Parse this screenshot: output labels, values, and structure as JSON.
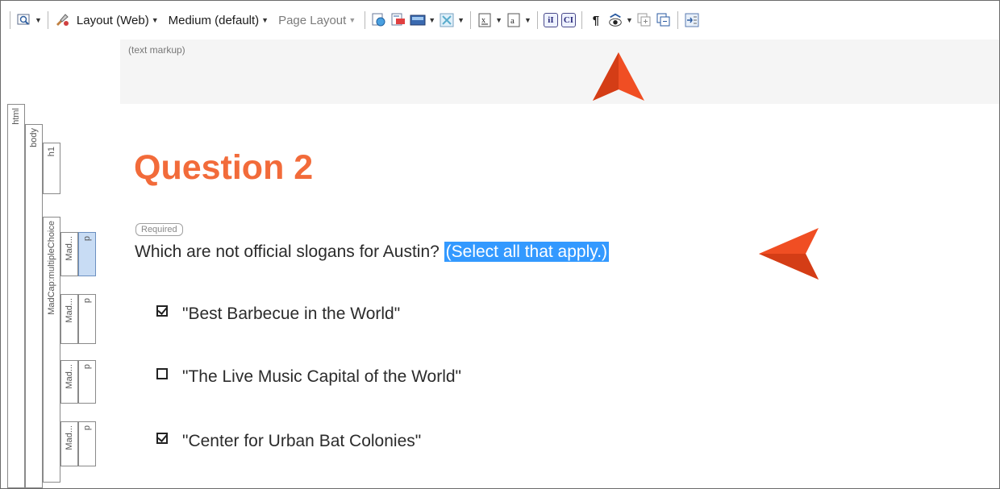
{
  "toolbar": {
    "layout_label": "Layout (Web)",
    "medium_label": "Medium (default)",
    "page_layout_label": "Page Layout"
  },
  "markup": {
    "label": "(text markup)"
  },
  "structure": {
    "html": "html",
    "body": "body",
    "h1": "h1",
    "multiple_choice": "MadCap:multipleChoice",
    "mad1": "Mad...",
    "mad2": "Mad...",
    "mad3": "Mad...",
    "mad4": "Mad...",
    "p1": "p",
    "p2": "p",
    "p3": "p",
    "p4": "p"
  },
  "content": {
    "heading": "Question 2",
    "required_badge": "Required",
    "question_text": "Which are not official slogans for Austin? ",
    "question_highlight": "(Select all that apply.)",
    "choices": [
      {
        "label": "\"Best Barbecue in the World\"",
        "checked": true
      },
      {
        "label": "\"The Live Music Capital of the World\"",
        "checked": false
      },
      {
        "label": "\"Center for Urban Bat Colonies\"",
        "checked": true
      }
    ]
  },
  "colors": {
    "heading": "#f26b3a",
    "highlight": "#3399ff",
    "arrow": "#f04e23"
  }
}
